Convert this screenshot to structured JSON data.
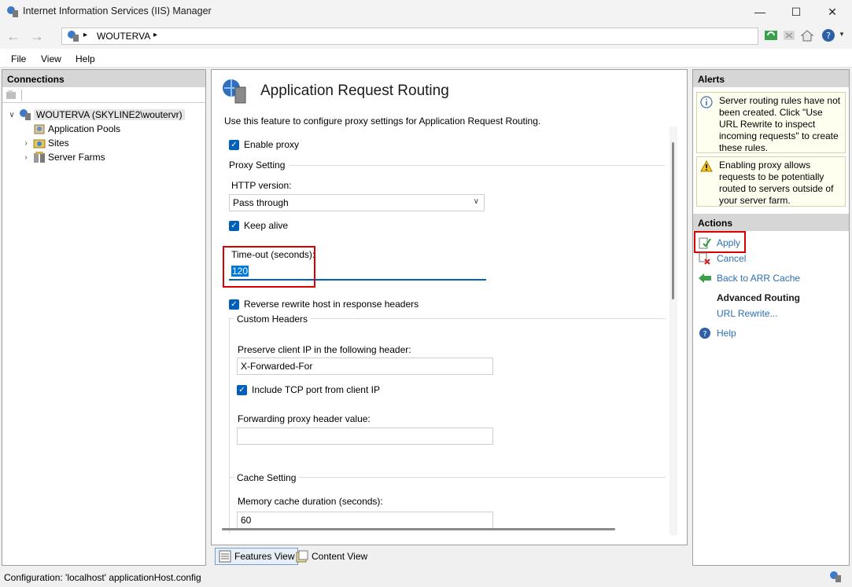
{
  "window": {
    "title": "Internet Information Services (IIS) Manager",
    "minimize": "—",
    "maximize": "☐",
    "close": "✕"
  },
  "address": {
    "path_sep1": "▸",
    "server": "WOUTERVA",
    "path_sep2": "▸"
  },
  "menu": [
    "File",
    "View",
    "Help"
  ],
  "connections": {
    "header": "Connections",
    "tree": {
      "server": "WOUTERVA (SKYLINE2\\woutervr)",
      "children": [
        "Application Pools",
        "Sites",
        "Server Farms"
      ]
    }
  },
  "center": {
    "title": "Application Request Routing",
    "description": "Use this feature to configure proxy settings for Application Request Routing.",
    "enable_proxy": "Enable proxy",
    "proxy_setting": "Proxy Setting",
    "http_version_label": "HTTP version:",
    "http_version_value": "Pass through",
    "keep_alive": "Keep alive",
    "timeout_label": "Time-out (seconds):",
    "timeout_value": "120",
    "reverse_rewrite": "Reverse rewrite host in response headers",
    "custom_headers": "Custom Headers",
    "preserve_ip_label": "Preserve client IP in the following header:",
    "preserve_ip_value": "X-Forwarded-For",
    "include_tcp": "Include TCP port from client IP",
    "forwarding_label": "Forwarding proxy header value:",
    "forwarding_value": "",
    "cache_setting": "Cache Setting",
    "memory_cache_label": "Memory cache duration (seconds):",
    "memory_cache_value": "60"
  },
  "views": {
    "features": "Features View",
    "content": "Content View"
  },
  "right": {
    "alerts_header": "Alerts",
    "alert1": "Server routing rules have not been created. Click \"Use URL Rewrite to inspect incoming requests\" to create these rules.",
    "alert2": "Enabling proxy allows requests to be potentially routed to servers outside of your server farm.",
    "actions_header": "Actions",
    "apply": "Apply",
    "cancel": "Cancel",
    "back": "Back to ARR Cache",
    "advanced_routing": "Advanced Routing",
    "url_rewrite": "URL Rewrite...",
    "help": "Help"
  },
  "status": {
    "text": "Configuration: 'localhost' applicationHost.config"
  },
  "colors": {
    "accent": "#005fb8",
    "link": "#2c6fb6",
    "highlight_box": "#d80000"
  }
}
